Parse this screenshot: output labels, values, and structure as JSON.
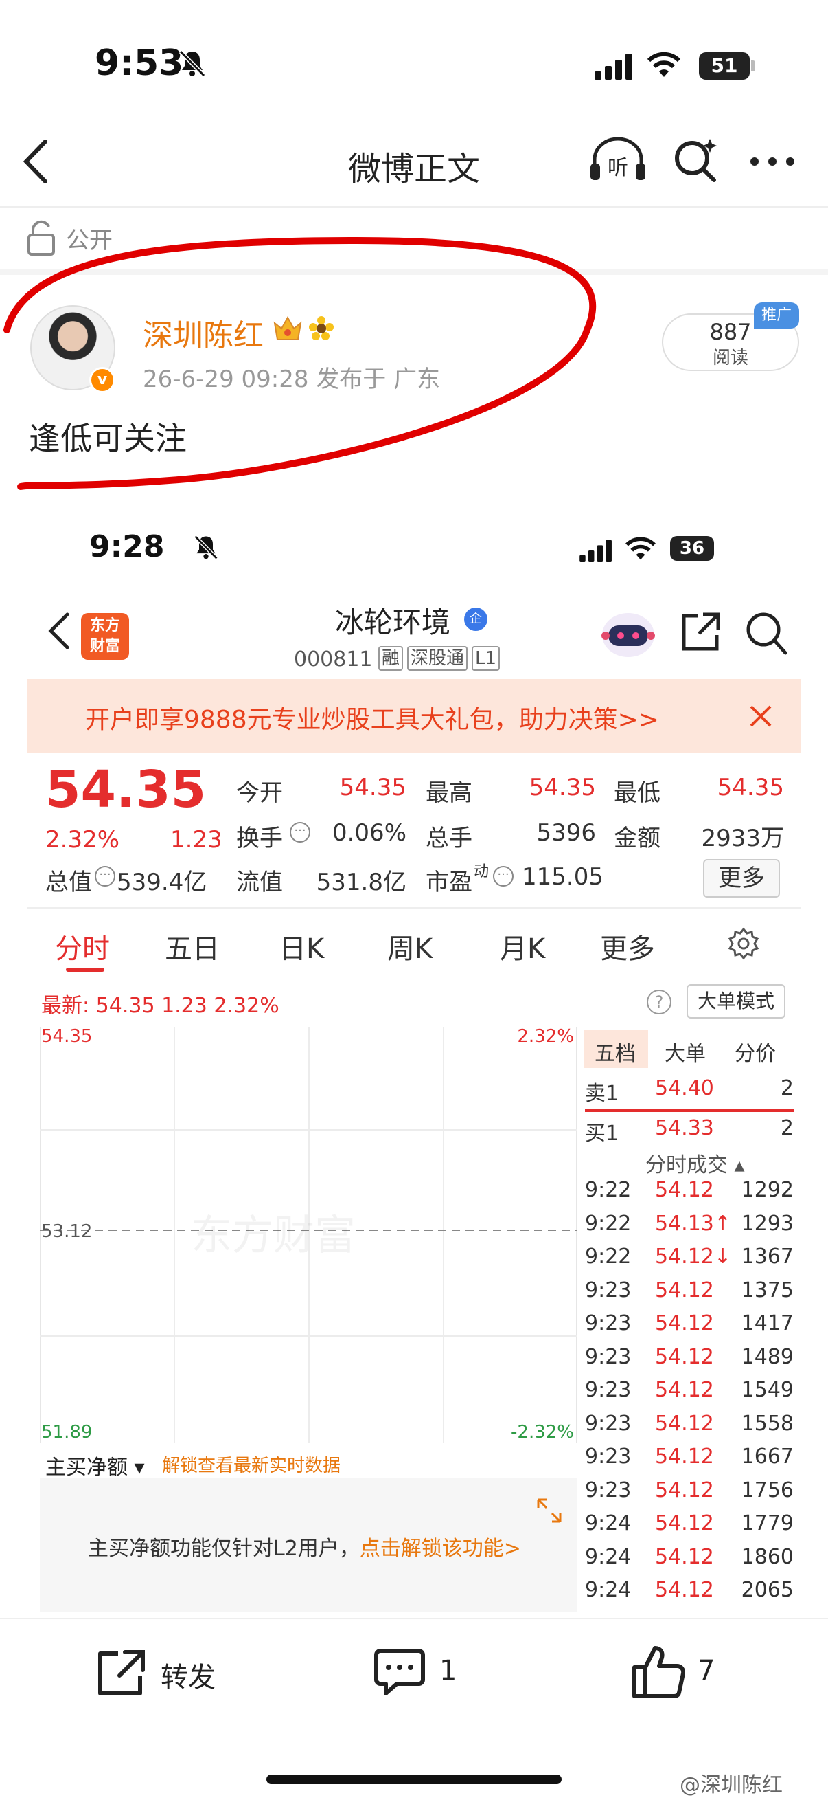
{
  "status_bar": {
    "time": "9:53",
    "battery": "51"
  },
  "nav": {
    "title": "微博正文"
  },
  "visibility": {
    "label": "公开"
  },
  "post": {
    "author": "深圳陈红",
    "verified_badge": "v",
    "meta": "26-6-29 09:28  发布于 广东",
    "reads_count": "887",
    "reads_label": "阅读",
    "promo_badge": "推广",
    "text": "逢低可关注"
  },
  "embedded": {
    "status_time": "9:28",
    "battery": "36",
    "logo_line1": "东方",
    "logo_line2": "财富",
    "stock_name": "冰轮环境",
    "name_badge": "企",
    "stock_code": "000811",
    "tags": [
      "融",
      "深股通",
      "L1"
    ],
    "ad_text": "开户即享9888元专业炒股工具大礼包，助力决策>>",
    "price": "54.35",
    "change_pct": "2.32%",
    "change": "1.23",
    "quote": {
      "open_label": "今开",
      "open": "54.35",
      "high_label": "最高",
      "high": "54.35",
      "low_label": "最低",
      "low": "54.35",
      "turnover_label": "换手",
      "turnover": "0.06%",
      "volume_label": "总手",
      "volume": "5396",
      "amount_label": "金额",
      "amount": "2933万",
      "mcap_label": "总值",
      "mcap": "539.4亿",
      "float_label": "流值",
      "float": "531.8亿",
      "pe_label": "市盈",
      "pe_sup": "动",
      "pe": "115.05",
      "more": "更多"
    },
    "tabs": [
      "分时",
      "五日",
      "日K",
      "周K",
      "月K",
      "更多"
    ],
    "latest_line": "最新: 54.35  1.23  2.32%",
    "help_icon": "?",
    "big_order_mode": "大单模式",
    "chart_labels": {
      "top_left": "54.35",
      "top_right": "2.32%",
      "mid": "53.12",
      "bottom_left": "51.89",
      "bottom_right": "-2.32%",
      "watermark": "东方财富"
    },
    "orderbook_tabs": [
      "五档",
      "大单",
      "分价"
    ],
    "sell1": {
      "label": "卖1",
      "price": "54.40",
      "vol": "2"
    },
    "buy1": {
      "label": "买1",
      "price": "54.33",
      "vol": "2"
    },
    "ticks_header": "分时成交 ▴",
    "ticks": [
      {
        "t": "9:22",
        "p": "54.12",
        "v": "1292"
      },
      {
        "t": "9:22",
        "p": "54.13↑",
        "v": "1293"
      },
      {
        "t": "9:22",
        "p": "54.12↓",
        "v": "1367"
      },
      {
        "t": "9:23",
        "p": "54.12",
        "v": "1375"
      },
      {
        "t": "9:23",
        "p": "54.12",
        "v": "1417"
      },
      {
        "t": "9:23",
        "p": "54.12",
        "v": "1489"
      },
      {
        "t": "9:23",
        "p": "54.12",
        "v": "1549"
      },
      {
        "t": "9:23",
        "p": "54.12",
        "v": "1558"
      },
      {
        "t": "9:23",
        "p": "54.12",
        "v": "1667"
      },
      {
        "t": "9:23",
        "p": "54.12",
        "v": "1756"
      },
      {
        "t": "9:24",
        "p": "54.12",
        "v": "1779"
      },
      {
        "t": "9:24",
        "p": "54.12",
        "v": "1860"
      },
      {
        "t": "9:24",
        "p": "54.12",
        "v": "2065"
      }
    ],
    "net_buy_label": "主买净额 ▾",
    "net_buy_unlock": "解锁查看最新实时数据",
    "l2_text": "主买净额功能仅针对L2用户，",
    "l2_link": "点击解锁该功能>"
  },
  "bottom_bar": {
    "forward": "转发",
    "comments": "1",
    "likes": "7"
  },
  "watermark": "@深圳陈红",
  "colors": {
    "accent_orange": "#e8780f",
    "stock_red": "#e42d2d",
    "annotation_red": "#e00000"
  }
}
